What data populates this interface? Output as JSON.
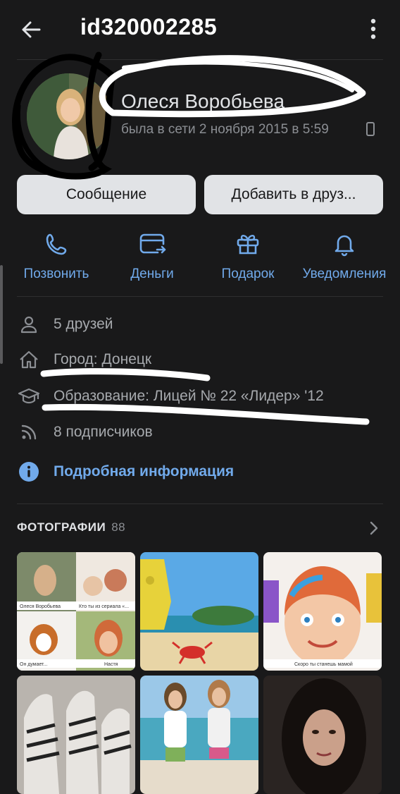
{
  "header": {
    "title": "id320002285"
  },
  "profile": {
    "name": "Олеся Воробьева",
    "status": "была в сети 2 ноября 2015 в 5:59"
  },
  "buttons": {
    "message": "Сообщение",
    "add_friend": "Добавить в друз..."
  },
  "actions": [
    {
      "label": "Позвонить",
      "icon": "phone-icon"
    },
    {
      "label": "Деньги",
      "icon": "money-transfer-icon"
    },
    {
      "label": "Подарок",
      "icon": "gift-icon"
    },
    {
      "label": "Уведомления",
      "icon": "bell-icon"
    }
  ],
  "info": [
    {
      "text": "5 друзей",
      "icon": "person-icon"
    },
    {
      "text": "Город: Донецк",
      "icon": "home-icon"
    },
    {
      "text": "Образование: Лицей № 22 «Лидер» '12",
      "icon": "graduation-cap-icon"
    },
    {
      "text": "8 подписчиков",
      "icon": "rss-icon"
    }
  ],
  "more_info": {
    "text": "Подробная информация",
    "icon": "info-icon"
  },
  "photos": {
    "title": "ФОТОГРАФИИ",
    "count": "88",
    "collage_captions": [
      "Олеся Воробьева",
      "Кто ты из сериала «...",
      "Он думает...",
      "Настя"
    ],
    "caption_kid": "Скоро ты станешь мамой"
  },
  "colors": {
    "background": "#19191a",
    "accent": "#71aaeb",
    "button": "#e1e3e6",
    "muted": "#8b8e93"
  }
}
